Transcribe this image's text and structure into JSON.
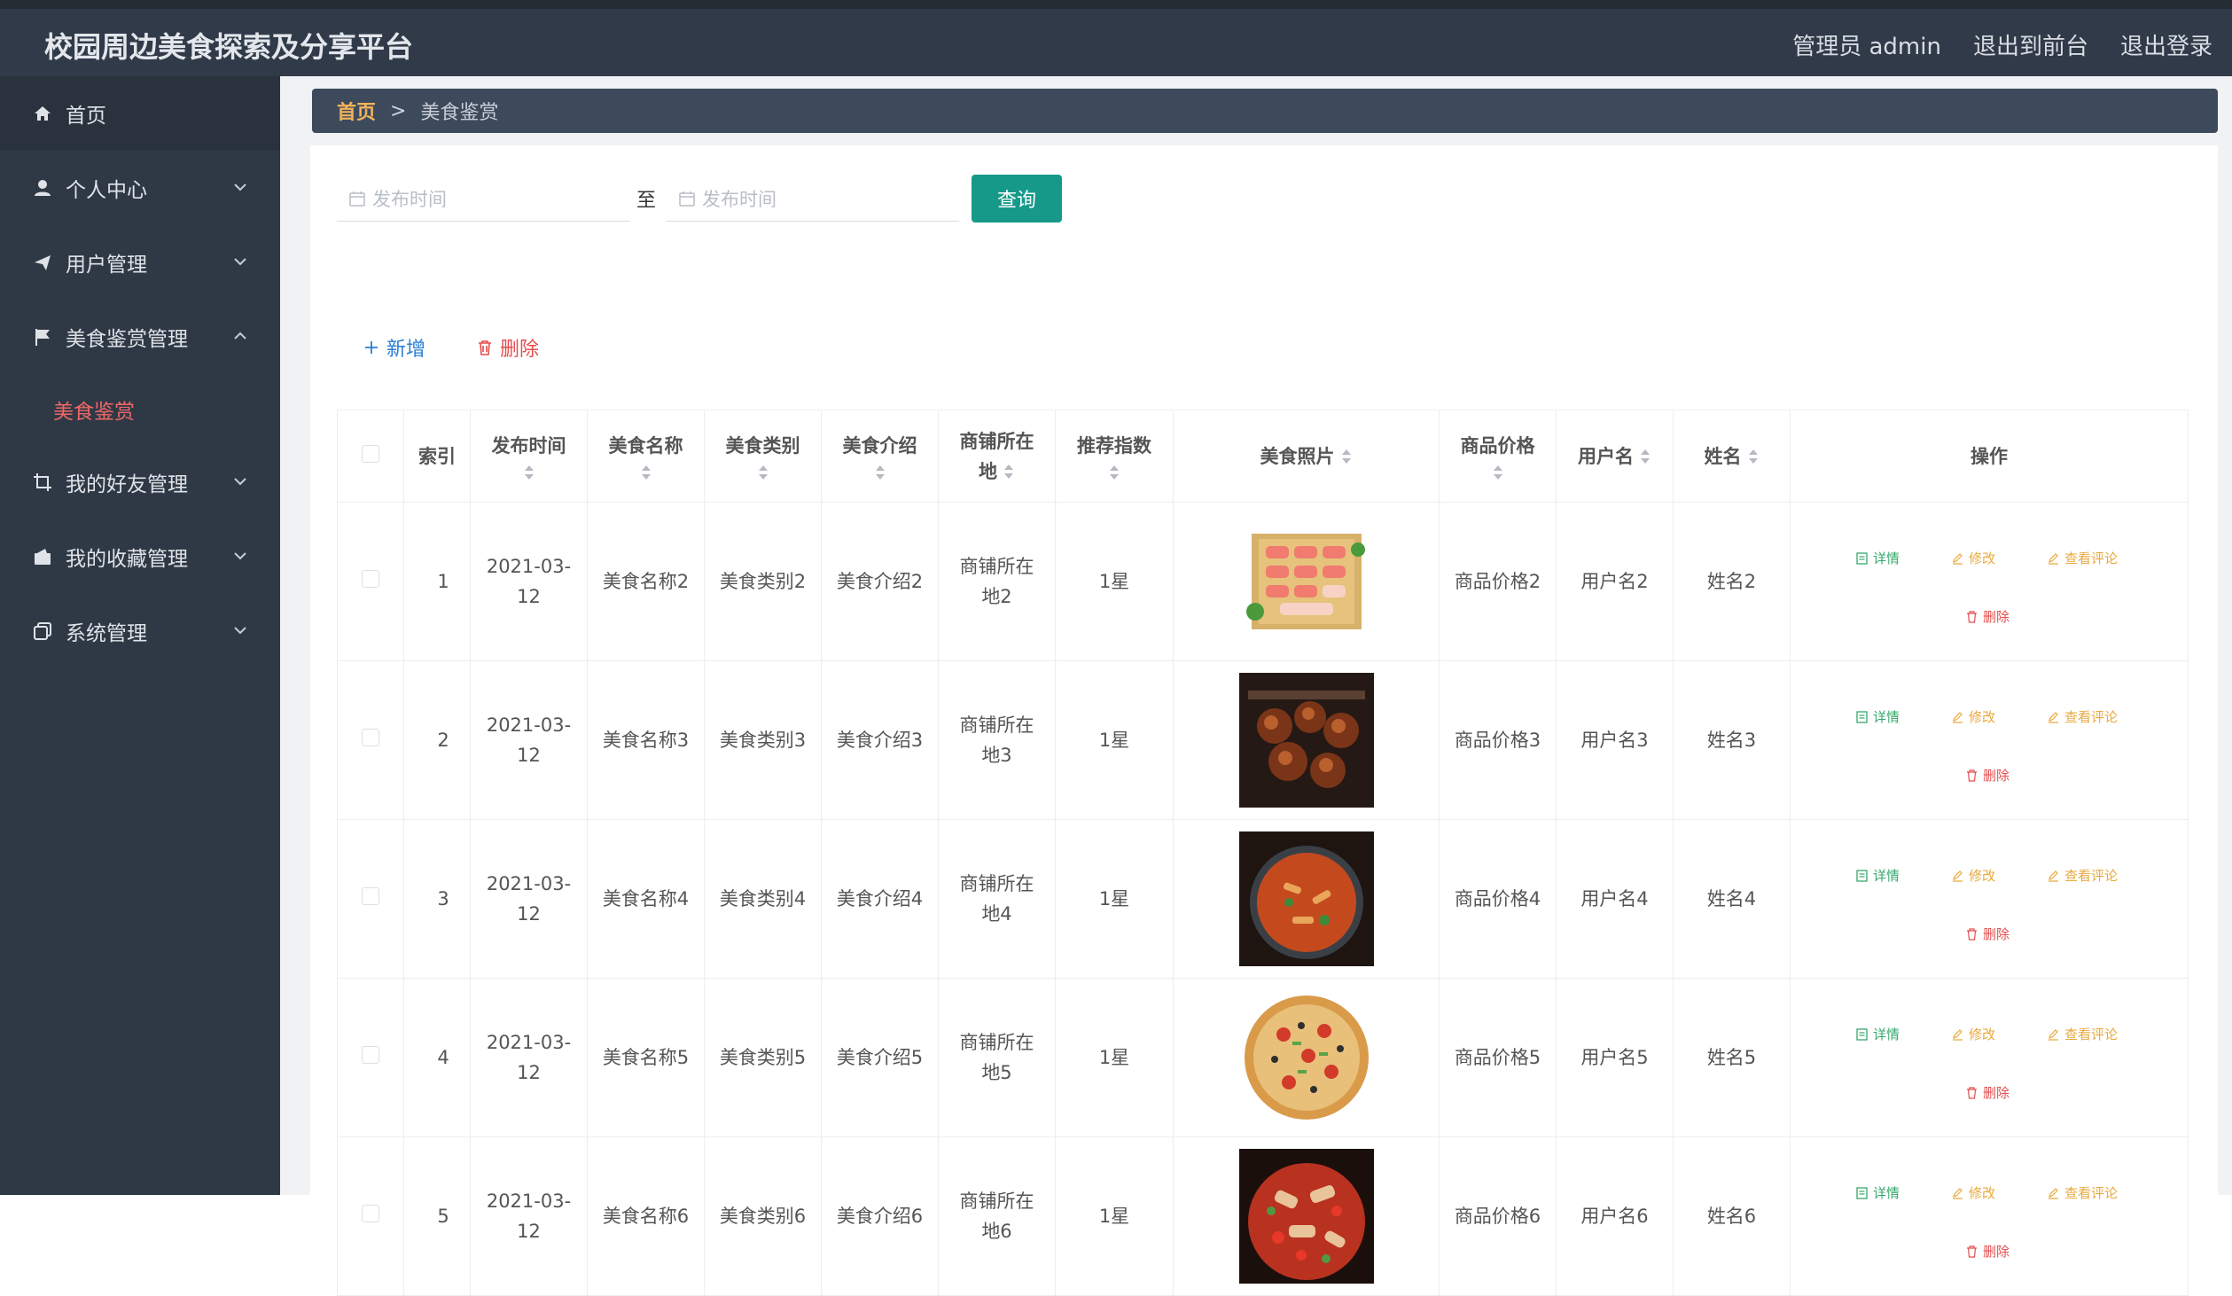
{
  "header": {
    "title": "校园周边美食探索及分享平台",
    "admin": "管理员 admin",
    "to_front": "退出到前台",
    "logout": "退出登录"
  },
  "sidebar": {
    "items": [
      {
        "label": "首页",
        "icon": "home-icon"
      },
      {
        "label": "个人中心",
        "icon": "user-icon"
      },
      {
        "label": "用户管理",
        "icon": "send-icon"
      },
      {
        "label": "美食鉴赏管理",
        "icon": "flag-icon"
      },
      {
        "label": "我的好友管理",
        "icon": "crop-icon"
      },
      {
        "label": "我的收藏管理",
        "icon": "wallet-icon"
      },
      {
        "label": "系统管理",
        "icon": "copy-icon"
      }
    ],
    "subitem": {
      "label": "美食鉴赏"
    }
  },
  "breadcrumb": {
    "home": "首页",
    "sep": ">",
    "current": "美食鉴赏"
  },
  "search": {
    "start_placeholder": "发布时间",
    "to": "至",
    "end_placeholder": "发布时间",
    "query": "查询"
  },
  "actions": {
    "add": "新增",
    "delete": "删除"
  },
  "table": {
    "headers": {
      "index": "索引",
      "publish_time": "发布时间",
      "name": "美食名称",
      "category": "美食类别",
      "intro": "美食介绍",
      "shop_loc": "商铺所在地",
      "rating": "推荐指数",
      "photo": "美食照片",
      "price": "商品价格",
      "username": "用户名",
      "realname": "姓名",
      "ops": "操作"
    },
    "ops": {
      "detail": "详情",
      "edit": "修改",
      "comment": "查看评论",
      "remove": "删除"
    },
    "rows": [
      {
        "index": "1",
        "date_a": "2021-03-",
        "date_b": "12",
        "name": "美食名称2",
        "category": "美食类别2",
        "intro": "美食介绍2",
        "shop_a": "商铺所在",
        "shop_b": "地2",
        "rating": "1星",
        "price": "商品价格2",
        "username": "用户名2",
        "realname": "姓名2"
      },
      {
        "index": "2",
        "date_a": "2021-03-",
        "date_b": "12",
        "name": "美食名称3",
        "category": "美食类别3",
        "intro": "美食介绍3",
        "shop_a": "商铺所在",
        "shop_b": "地3",
        "rating": "1星",
        "price": "商品价格3",
        "username": "用户名3",
        "realname": "姓名3"
      },
      {
        "index": "3",
        "date_a": "2021-03-",
        "date_b": "12",
        "name": "美食名称4",
        "category": "美食类别4",
        "intro": "美食介绍4",
        "shop_a": "商铺所在",
        "shop_b": "地4",
        "rating": "1星",
        "price": "商品价格4",
        "username": "用户名4",
        "realname": "姓名4"
      },
      {
        "index": "4",
        "date_a": "2021-03-",
        "date_b": "12",
        "name": "美食名称5",
        "category": "美食类别5",
        "intro": "美食介绍5",
        "shop_a": "商铺所在",
        "shop_b": "地5",
        "rating": "1星",
        "price": "商品价格5",
        "username": "用户名5",
        "realname": "姓名5"
      },
      {
        "index": "5",
        "date_a": "2021-03-",
        "date_b": "12",
        "name": "美食名称6",
        "category": "美食类别6",
        "intro": "美食介绍6",
        "shop_a": "商铺所在",
        "shop_b": "地6",
        "rating": "1星",
        "price": "商品价格6",
        "username": "用户名6",
        "realname": "姓名6"
      }
    ]
  },
  "colors": {
    "header_bg": "#303a48",
    "sidebar_bg": "#2f3946",
    "accent_teal": "#17998a",
    "active_red": "#f06767",
    "crumb_orange": "#f2b35a"
  }
}
